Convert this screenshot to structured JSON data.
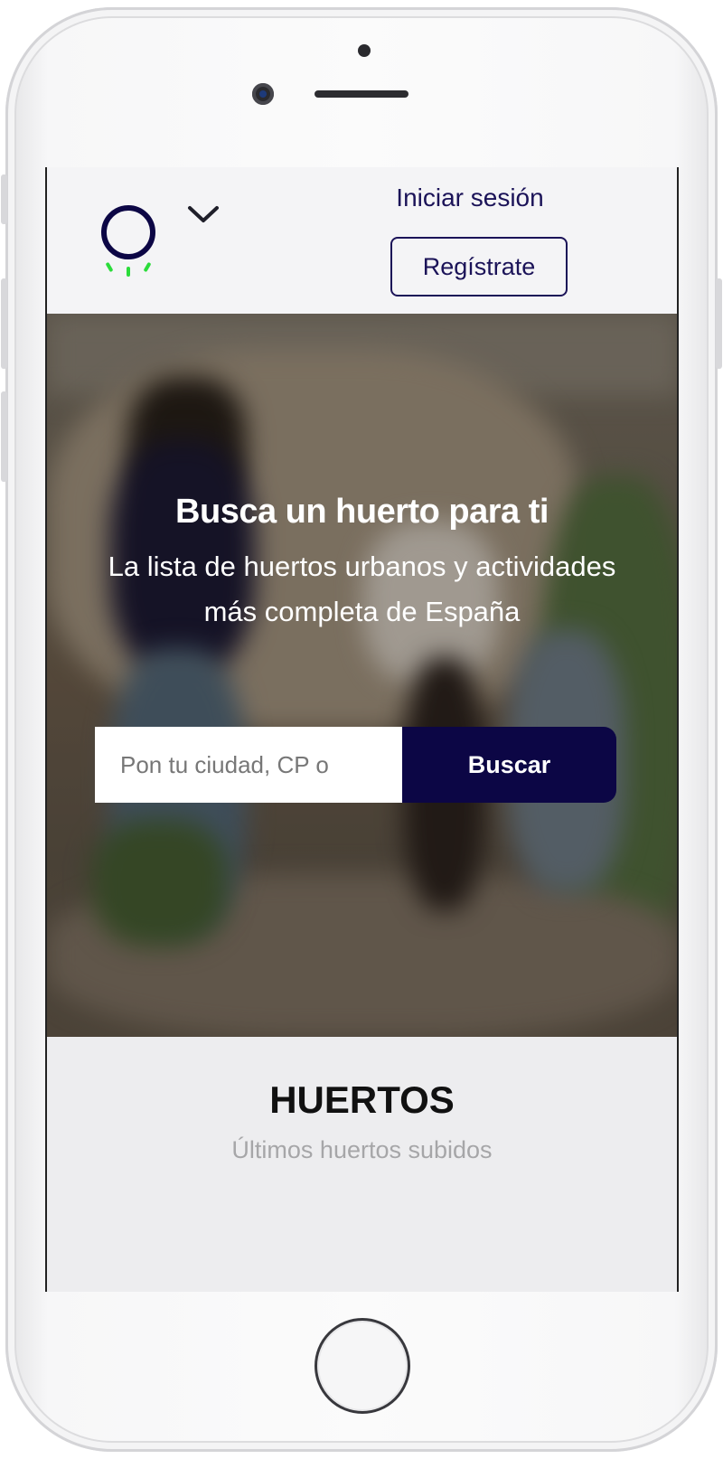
{
  "header": {
    "logo_icon": "huerto-logo-icon",
    "menu_icon": "chevron-down-icon",
    "login_label": "Iniciar sesión",
    "register_label": "Regístrate"
  },
  "hero": {
    "title": "Busca un huerto para ti",
    "subtitle_line1": "La lista de huertos urbanos y actividades",
    "subtitle_line2": "más completa de España",
    "search_placeholder": "Pon tu ciudad, CP o",
    "search_button": "Buscar"
  },
  "section": {
    "title": "HUERTOS",
    "subtitle": "Últimos huertos subidos"
  },
  "colors": {
    "brand_navy": "#0c0645",
    "accent_green": "#2bdc3b"
  }
}
